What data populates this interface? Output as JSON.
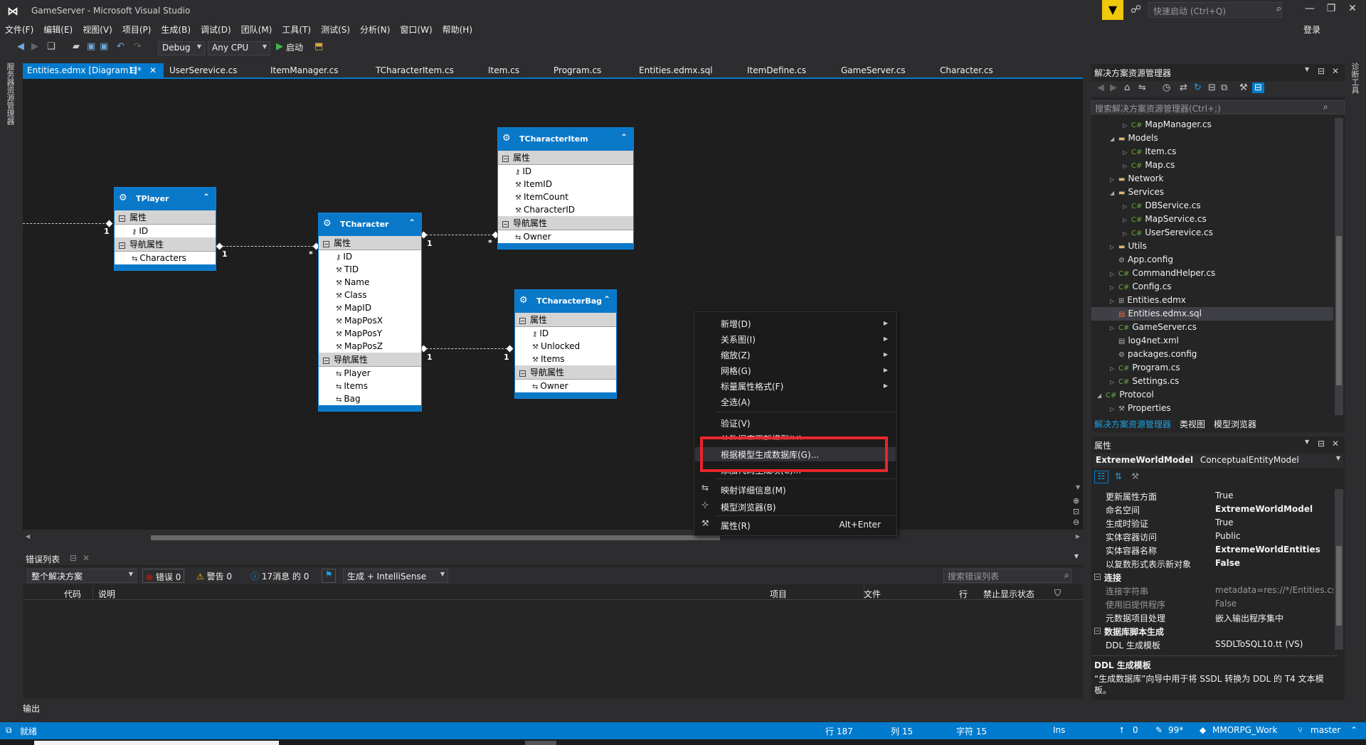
{
  "window": {
    "title": "GameServer - Microsoft Visual Studio",
    "quick_launch_placeholder": "快速启动 (Ctrl+Q)",
    "login": "登录"
  },
  "menu": [
    "文件(F)",
    "编辑(E)",
    "视图(V)",
    "项目(P)",
    "生成(B)",
    "调试(D)",
    "团队(M)",
    "工具(T)",
    "测试(S)",
    "分析(N)",
    "窗口(W)",
    "帮助(H)"
  ],
  "toolbar": {
    "config": "Debug",
    "platform": "Any CPU",
    "start": "启动"
  },
  "left_strip": "服务器资源管理器",
  "right_strip": "诊断工具",
  "tabs": [
    {
      "label": "Entities.edmx [Diagram1]*",
      "active": true
    },
    {
      "label": "UserSerevice.cs"
    },
    {
      "label": "ItemManager.cs"
    },
    {
      "label": "TCharacterItem.cs"
    },
    {
      "label": "Item.cs"
    },
    {
      "label": "Program.cs"
    },
    {
      "label": "Entities.edmx.sql"
    },
    {
      "label": "ItemDefine.cs"
    },
    {
      "label": "GameServer.cs"
    },
    {
      "label": "Character.cs"
    }
  ],
  "entities": {
    "section_props": "属性",
    "section_nav": "导航属性",
    "tplayer": {
      "name": "TPlayer",
      "props": [
        "ID"
      ],
      "nav": [
        "Characters"
      ]
    },
    "tcharacter": {
      "name": "TCharacter",
      "props": [
        "ID",
        "TID",
        "Name",
        "Class",
        "MapID",
        "MapPosX",
        "MapPosY",
        "MapPosZ"
      ],
      "nav": [
        "Player",
        "Items",
        "Bag"
      ]
    },
    "tcharacteritem": {
      "name": "TCharacterItem",
      "props": [
        "ID",
        "ItemID",
        "ItemCount",
        "CharacterID"
      ],
      "nav": [
        "Owner"
      ]
    },
    "tcharacterbag": {
      "name": "TCharacterBag",
      "props": [
        "ID",
        "Unlocked",
        "Items"
      ],
      "nav": [
        "Owner"
      ]
    }
  },
  "multiplicity": {
    "one": "1",
    "many": "*"
  },
  "context_menu": {
    "items": [
      {
        "label": "新增(D)",
        "submenu": true
      },
      {
        "label": "关系图(I)",
        "submenu": true
      },
      {
        "label": "缩放(Z)",
        "submenu": true
      },
      {
        "label": "网格(G)",
        "submenu": true
      },
      {
        "label": "标量属性格式(F)",
        "submenu": true
      },
      {
        "label": "全选(A)"
      },
      {
        "label": "验证(V)"
      },
      {
        "label": "从数据库更新模型(U)..."
      },
      {
        "label": "根据模型生成数据库(G)..."
      },
      {
        "label": "添加代码生成项(C)..."
      },
      {
        "label": "映射详细信息(M)"
      },
      {
        "label": "模型浏览器(B)"
      },
      {
        "label": "属性(R)",
        "shortcut": "Alt+Enter"
      }
    ]
  },
  "error_list": {
    "title": "错误列表",
    "scope": "整个解决方案",
    "errors": "错误 0",
    "warnings": "警告 0",
    "messages": "17消息 的 0",
    "build": "生成 + IntelliSense",
    "search_placeholder": "搜索错误列表",
    "columns": [
      "代码",
      "说明",
      "项目",
      "文件",
      "行",
      "禁止显示状态"
    ]
  },
  "output_label": "输出",
  "solution_explorer": {
    "title": "解决方案资源管理器",
    "search_placeholder": "搜索解决方案资源管理器(Ctrl+;)",
    "items": [
      {
        "label": "MapManager.cs",
        "type": "cs",
        "depth": 2
      },
      {
        "label": "Models",
        "type": "folder",
        "depth": 1,
        "expanded": true
      },
      {
        "label": "Item.cs",
        "type": "cs",
        "depth": 2
      },
      {
        "label": "Map.cs",
        "type": "cs",
        "depth": 2
      },
      {
        "label": "Network",
        "type": "folder",
        "depth": 1
      },
      {
        "label": "Services",
        "type": "folder",
        "depth": 1,
        "expanded": true
      },
      {
        "label": "DBService.cs",
        "type": "cs",
        "depth": 2
      },
      {
        "label": "MapService.cs",
        "type": "cs",
        "depth": 2
      },
      {
        "label": "UserSerevice.cs",
        "type": "cs",
        "depth": 2
      },
      {
        "label": "Utils",
        "type": "folder",
        "depth": 1
      },
      {
        "label": "App.config",
        "type": "cfg",
        "depth": 1
      },
      {
        "label": "CommandHelper.cs",
        "type": "cs",
        "depth": 1
      },
      {
        "label": "Config.cs",
        "type": "cs",
        "depth": 1
      },
      {
        "label": "Entities.edmx",
        "type": "cfg",
        "depth": 1
      },
      {
        "label": "Entities.edmx.sql",
        "type": "sql",
        "depth": 1,
        "selected": true
      },
      {
        "label": "GameServer.cs",
        "type": "cs",
        "depth": 1
      },
      {
        "label": "log4net.xml",
        "type": "cfg",
        "depth": 1
      },
      {
        "label": "packages.config",
        "type": "cfg",
        "depth": 1
      },
      {
        "label": "Program.cs",
        "type": "cs",
        "depth": 1
      },
      {
        "label": "Settings.cs",
        "type": "cs",
        "depth": 1
      },
      {
        "label": "Protocol",
        "type": "cs",
        "depth": 0,
        "expanded": true
      },
      {
        "label": "Properties",
        "type": "cfg",
        "depth": 1
      }
    ],
    "bottom_tabs": [
      "解决方案资源管理器",
      "类视图",
      "模型浏览器"
    ]
  },
  "properties": {
    "title": "属性",
    "object_name": "ExtremeWorldModel",
    "object_type": "ConceptualEntityModel",
    "rows": [
      {
        "k": "更新属性方面",
        "v": "True"
      },
      {
        "k": "命名空间",
        "v": "ExtremeWorldModel",
        "bold": true
      },
      {
        "k": "生成时验证",
        "v": "True"
      },
      {
        "k": "实体容器访问",
        "v": "Public"
      },
      {
        "k": "实体容器名称",
        "v": "ExtremeWorldEntities",
        "bold": true
      },
      {
        "k": "以复数形式表示新对象",
        "v": "False",
        "bold": true
      }
    ],
    "cat_connection": "连接",
    "conn_rows": [
      {
        "k": "连接字符串",
        "v": "metadata=res://*/Entities.csdl|",
        "dim": true
      },
      {
        "k": "使用旧提供程序",
        "v": "False",
        "dim": true
      },
      {
        "k": "元数据项目处理",
        "v": "嵌入输出程序集中"
      }
    ],
    "cat_ddl": "数据库脚本生成",
    "ddl_rows": [
      {
        "k": "DDL 生成模板",
        "v": "SSDLToSQL10.tt (VS)"
      }
    ],
    "desc_title": "DDL 生成模板",
    "desc_text": "“生成数据库”向导中用于将 SSDL 转换为 DDL 的 T4 文本模板。"
  },
  "status": {
    "ready": "就绪",
    "line": "行 187",
    "col": "列 15",
    "char": "字符 15",
    "mode": "Ins",
    "push": "0",
    "pending": "99*",
    "repo": "MMORPG_Work",
    "branch": "master"
  }
}
